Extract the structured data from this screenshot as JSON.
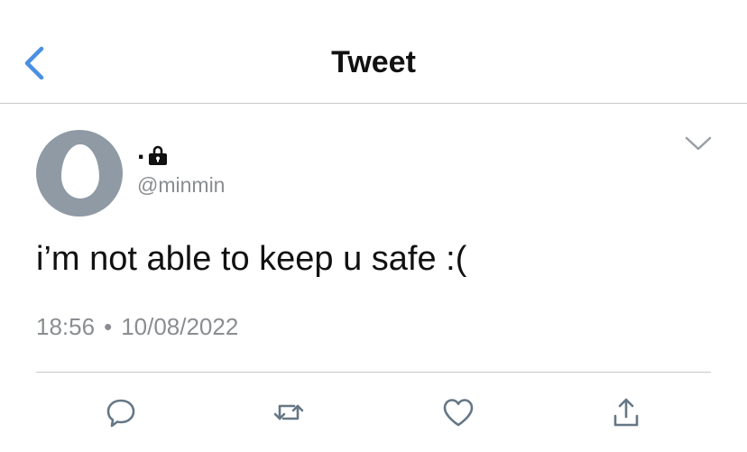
{
  "header": {
    "title": "Tweet",
    "back_icon": "chevron-left-icon"
  },
  "tweet": {
    "display_name": ".",
    "protected_icon": "lock-icon",
    "handle": "@minmin",
    "text": "i’m not able to keep u safe :(",
    "time": "18:56",
    "separator": "•",
    "date": "10/08/2022",
    "menu_icon": "chevron-down-icon"
  },
  "actions": [
    {
      "name": "reply",
      "icon": "reply-icon"
    },
    {
      "name": "retweet",
      "icon": "retweet-icon"
    },
    {
      "name": "like",
      "icon": "heart-icon"
    },
    {
      "name": "share",
      "icon": "share-icon"
    }
  ],
  "colors": {
    "accent": "#1da1f2",
    "back_blue": "#4a90e2",
    "icon_gray": "#657786",
    "avatar_bg": "#8f9aa5"
  }
}
